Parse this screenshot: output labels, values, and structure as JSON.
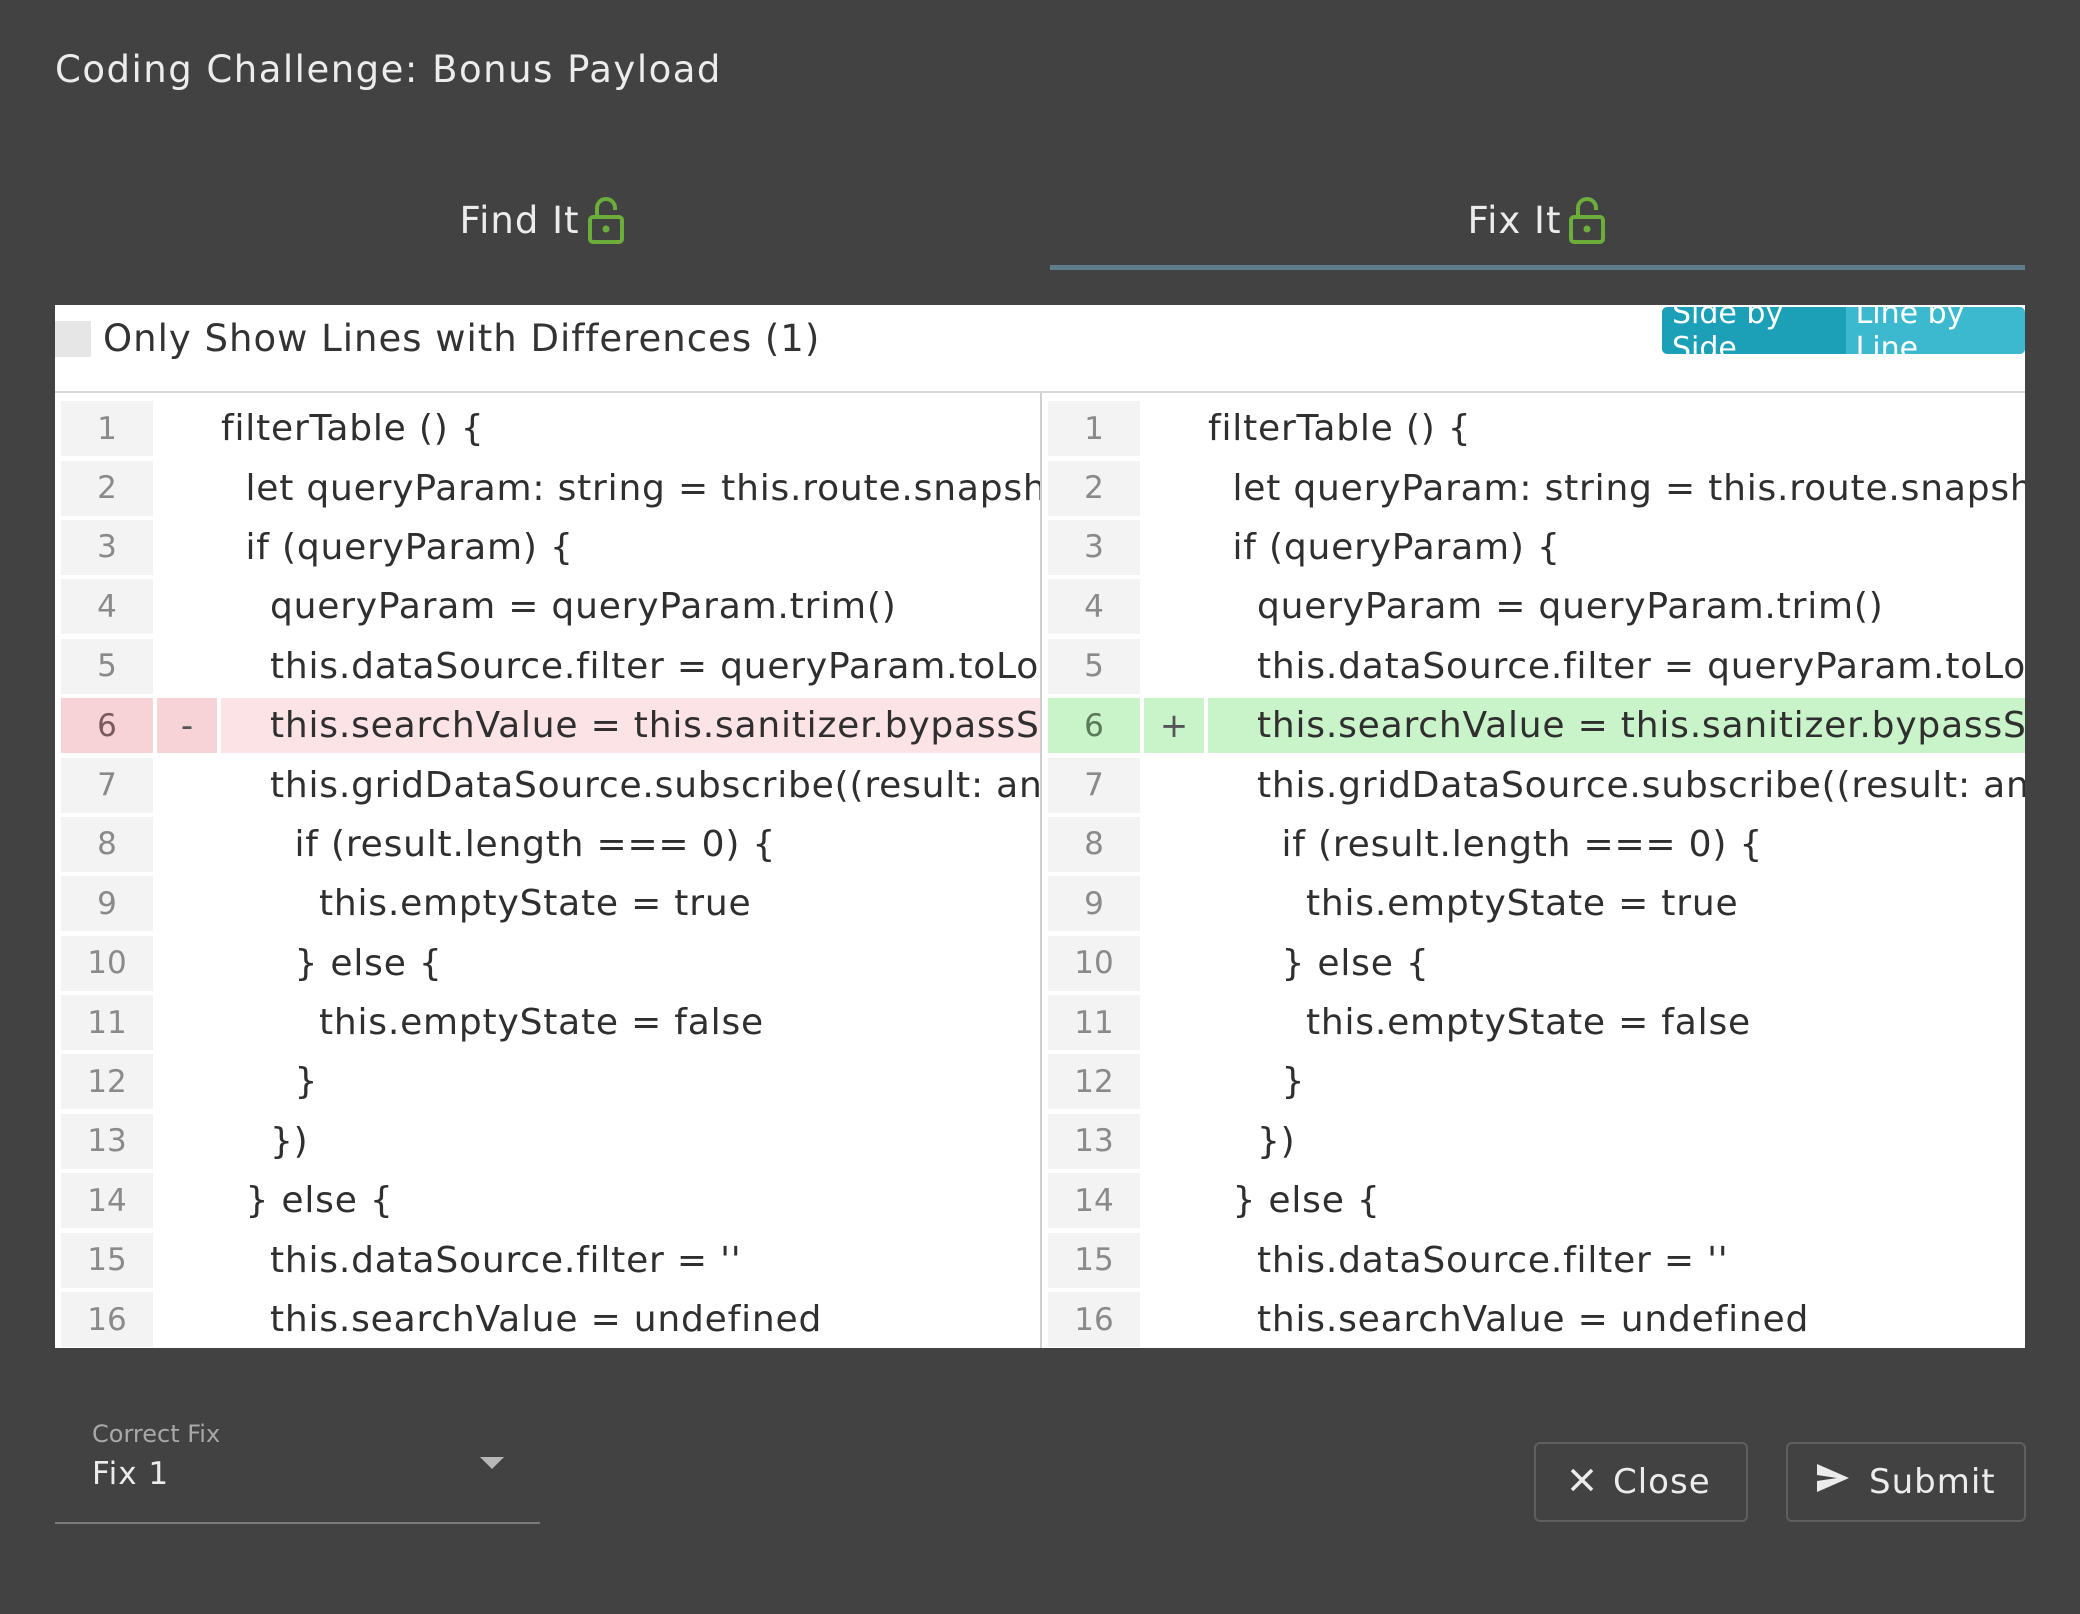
{
  "dialog": {
    "title": "Coding Challenge: Bonus Payload"
  },
  "tabs": [
    {
      "label": "Find It",
      "icon": "unlocked-lock-icon",
      "active": false
    },
    {
      "label": "Fix It",
      "icon": "unlocked-lock-icon",
      "active": true
    }
  ],
  "colors": {
    "background": "#424242",
    "lock_icon": "#6cad3c",
    "active_tab_ink": "#607d8b",
    "toggle_side_by_side": "#1ba0b8",
    "toggle_line_by_line": "#3cb9cf",
    "deleted_line": "#fbe3e6",
    "inserted_line": "#c9f3c9"
  },
  "diff": {
    "filter_label": "Only Show Lines with Differences (1)",
    "filter_checked": false,
    "view_toggle": {
      "side_by_side": "Side by Side",
      "line_by_line": "Line by Line"
    },
    "left": {
      "lines": [
        {
          "num": "1",
          "mark": "",
          "code": "filterTable () {",
          "type": "normal"
        },
        {
          "num": "2",
          "mark": "",
          "code": "  let queryParam: string = this.route.snapshot",
          "type": "normal"
        },
        {
          "num": "3",
          "mark": "",
          "code": "  if (queryParam) {",
          "type": "normal"
        },
        {
          "num": "4",
          "mark": "",
          "code": "    queryParam = queryParam.trim()",
          "type": "normal"
        },
        {
          "num": "5",
          "mark": "",
          "code": "    this.dataSource.filter = queryParam.toLowerCase()",
          "type": "normal"
        },
        {
          "num": "6",
          "mark": "-",
          "code": "    this.searchValue = this.sanitizer.bypassSecurityTrustHtml(queryParam)",
          "type": "del"
        },
        {
          "num": "7",
          "mark": "",
          "code": "    this.gridDataSource.subscribe((result: any) => {",
          "type": "normal"
        },
        {
          "num": "8",
          "mark": "",
          "code": "      if (result.length === 0) {",
          "type": "normal"
        },
        {
          "num": "9",
          "mark": "",
          "code": "        this.emptyState = true",
          "type": "normal"
        },
        {
          "num": "10",
          "mark": "",
          "code": "      } else {",
          "type": "normal"
        },
        {
          "num": "11",
          "mark": "",
          "code": "        this.emptyState = false",
          "type": "normal"
        },
        {
          "num": "12",
          "mark": "",
          "code": "      }",
          "type": "normal"
        },
        {
          "num": "13",
          "mark": "",
          "code": "    })",
          "type": "normal"
        },
        {
          "num": "14",
          "mark": "",
          "code": "  } else {",
          "type": "normal"
        },
        {
          "num": "15",
          "mark": "",
          "code": "    this.dataSource.filter = ''",
          "type": "normal"
        },
        {
          "num": "16",
          "mark": "",
          "code": "    this.searchValue = undefined",
          "type": "normal"
        }
      ]
    },
    "right": {
      "lines": [
        {
          "num": "1",
          "mark": "",
          "code": "filterTable () {",
          "type": "normal"
        },
        {
          "num": "2",
          "mark": "",
          "code": "  let queryParam: string = this.route.snapshot",
          "type": "normal"
        },
        {
          "num": "3",
          "mark": "",
          "code": "  if (queryParam) {",
          "type": "normal"
        },
        {
          "num": "4",
          "mark": "",
          "code": "    queryParam = queryParam.trim()",
          "type": "normal"
        },
        {
          "num": "5",
          "mark": "",
          "code": "    this.dataSource.filter = queryParam.toLowerCase()",
          "type": "normal"
        },
        {
          "num": "6",
          "mark": "+",
          "code": "    this.searchValue = this.sanitizer.bypassSecurityTrustStyle(queryParam)",
          "type": "ins"
        },
        {
          "num": "7",
          "mark": "",
          "code": "    this.gridDataSource.subscribe((result: any) => {",
          "type": "normal"
        },
        {
          "num": "8",
          "mark": "",
          "code": "      if (result.length === 0) {",
          "type": "normal"
        },
        {
          "num": "9",
          "mark": "",
          "code": "        this.emptyState = true",
          "type": "normal"
        },
        {
          "num": "10",
          "mark": "",
          "code": "      } else {",
          "type": "normal"
        },
        {
          "num": "11",
          "mark": "",
          "code": "        this.emptyState = false",
          "type": "normal"
        },
        {
          "num": "12",
          "mark": "",
          "code": "      }",
          "type": "normal"
        },
        {
          "num": "13",
          "mark": "",
          "code": "    })",
          "type": "normal"
        },
        {
          "num": "14",
          "mark": "",
          "code": "  } else {",
          "type": "normal"
        },
        {
          "num": "15",
          "mark": "",
          "code": "    this.dataSource.filter = ''",
          "type": "normal"
        },
        {
          "num": "16",
          "mark": "",
          "code": "    this.searchValue = undefined",
          "type": "normal"
        }
      ]
    }
  },
  "fix_select": {
    "label": "Correct Fix",
    "value": "Fix 1",
    "icon": "dropdown-arrow-icon"
  },
  "actions": {
    "close_label": "Close",
    "close_icon": "close-icon",
    "submit_label": "Submit",
    "submit_icon": "send-icon"
  }
}
